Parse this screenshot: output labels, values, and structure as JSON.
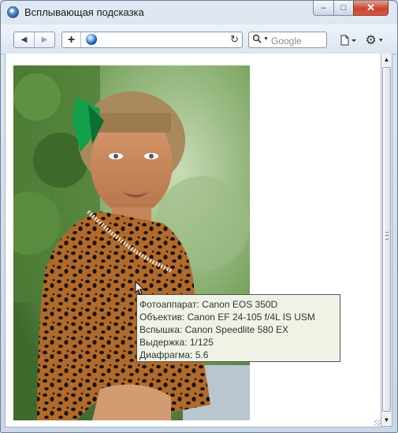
{
  "window": {
    "title": "Всплывающая подсказка",
    "buttons": {
      "minimize": "–",
      "maximize": "□",
      "close": "✕"
    }
  },
  "toolbar": {
    "back_icon": "◀",
    "forward_icon": "▶",
    "new_tab_icon": "+",
    "address_value": "",
    "reload_icon": "↻",
    "search_placeholder": "Google",
    "search_icon": "🔍",
    "page_menu_icon": "page-icon",
    "tools_menu_icon": "⚙"
  },
  "tooltip": {
    "lines": [
      "Фотоаппарат: Canon EOS 350D",
      "Объектив: Canon EF 24-105 f/4L IS USM",
      "Вспышка: Canon Speedlite 580 EX",
      "Выдержка: 1/125",
      "Диафрагма: 5.6"
    ]
  },
  "scrollbar": {
    "up_icon": "▲",
    "down_icon": "▼"
  }
}
